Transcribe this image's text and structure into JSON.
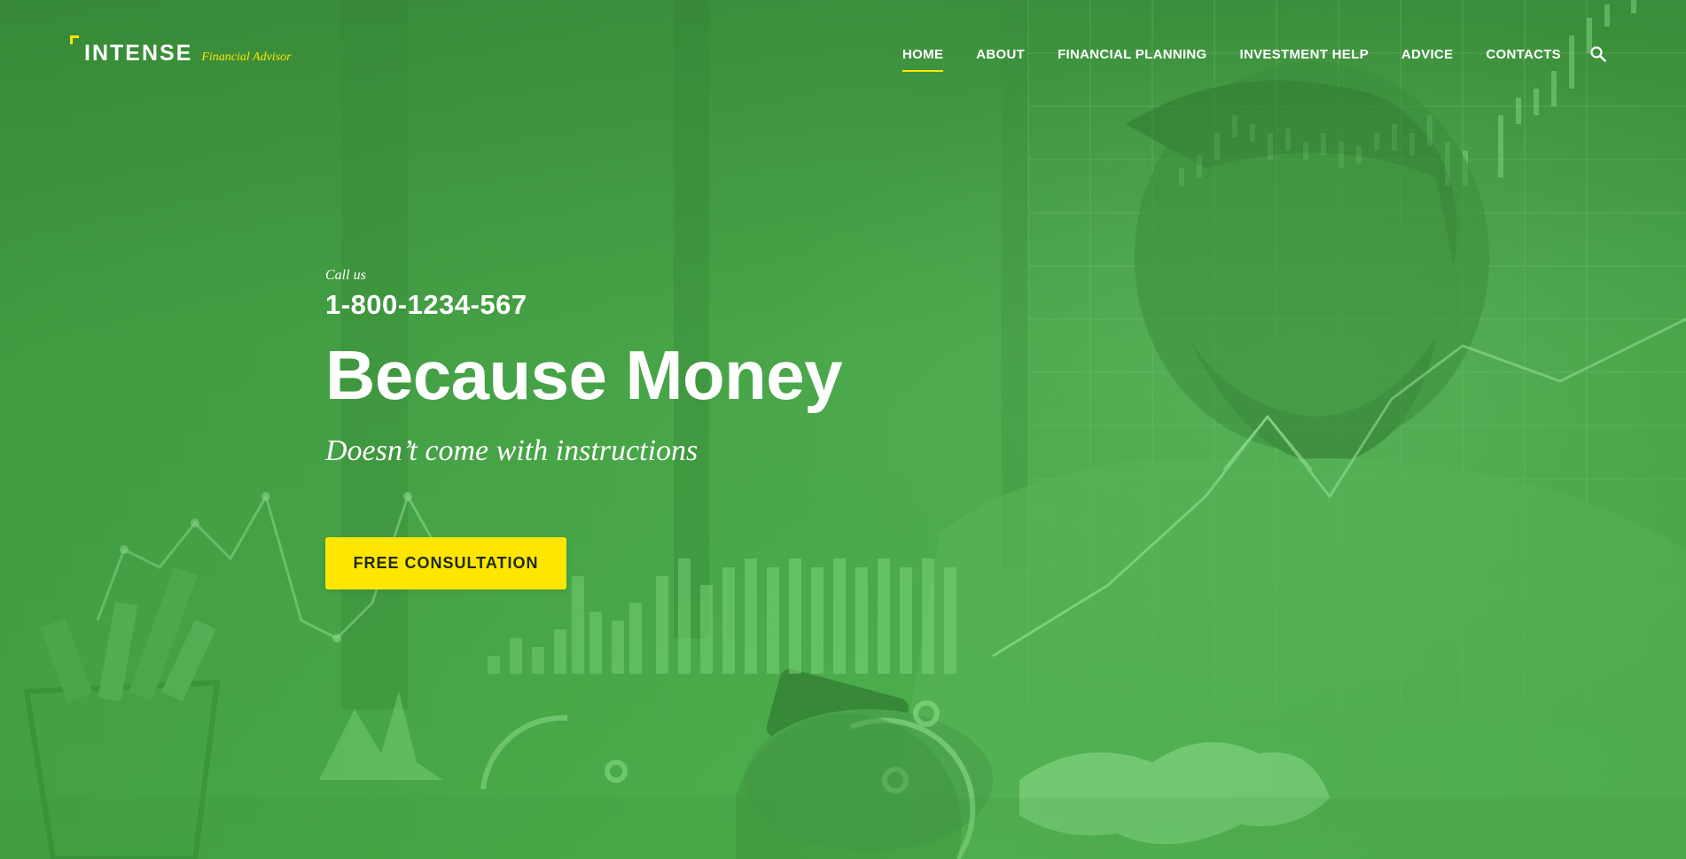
{
  "brand": {
    "name": "INTENSE",
    "tagline": "Financial Advisor",
    "accent_color": "#ffe600",
    "overlay_color": "#4aa84a"
  },
  "nav": {
    "items": [
      {
        "label": "HOME",
        "active": true
      },
      {
        "label": "ABOUT",
        "active": false
      },
      {
        "label": "FINANCIAL PLANNING",
        "active": false
      },
      {
        "label": "INVESTMENT HELP",
        "active": false
      },
      {
        "label": "ADVICE",
        "active": false
      },
      {
        "label": "CONTACTS",
        "active": false
      }
    ],
    "search_icon": "search-icon"
  },
  "hero": {
    "call_label": "Call us",
    "phone": "1-800-1234-567",
    "headline": "Because Money",
    "subheadline": "Doesn’t come with instructions",
    "cta_label": "FREE CONSULTATION",
    "background_image": "man-using-phone-with-financial-charts-overlay"
  }
}
